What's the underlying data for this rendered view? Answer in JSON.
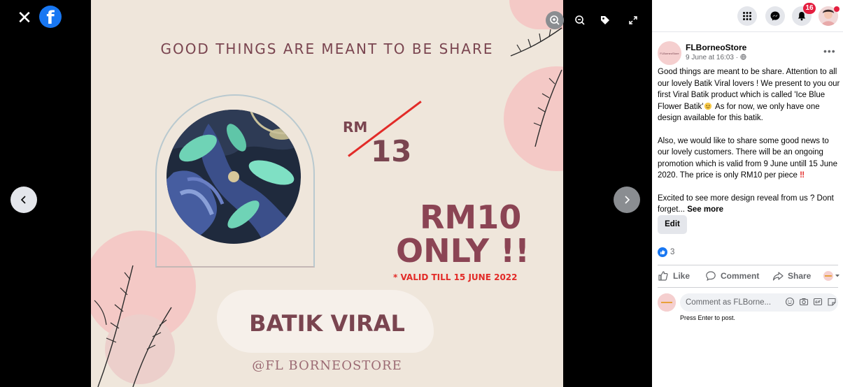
{
  "viewer": {
    "close_glyph": "✕",
    "fb_letter": "f",
    "poster": {
      "heading": "GOOD THINGS ARE MEANT TO BE SHARE",
      "old_currency": "RM",
      "old_value": "13",
      "new_price": "RM10",
      "only_text": "ONLY !!",
      "valid_text": "* VALID TILL 15 JUNE 2022",
      "brand": "BATIK VIRAL",
      "handle": "@FL BORNEOSTORE"
    },
    "colors": {
      "poster_bg": "#efe6db",
      "pink": "#f4c9c6",
      "maroon": "#7a4550",
      "red": "#e22b28"
    }
  },
  "topbar": {
    "notification_count": "16"
  },
  "post": {
    "page_name": "FLBorneoStore",
    "page_avatar_text": "FLBorneoStore",
    "timestamp": "9 June at 16:03",
    "meta_sep": " · ",
    "more": "•••",
    "para1_a": "Good things are meant to be share. Attention to all our lovely Batik Viral lovers ! We present to you our first Viral Batik product which is called 'Ice Blue Flower Batik'",
    "para1_b": " As for now, we only have one design available for this batik.",
    "para2_a": "Also, we would like to share some good news to our lovely customers. There will be an ongoing promotion which is valid from 9 June untill 15 June 2020. The price is only RM10 per piece ",
    "para2_b": "‼",
    "para3": "Excited to see more design reveal from us ? Dont forget... ",
    "see_more": "See more",
    "edit_label": "Edit",
    "reaction_count": "3",
    "like_label": "Like",
    "comment_label": "Comment",
    "share_label": "Share",
    "comment_placeholder": "Comment as FLBorne...",
    "press_enter": "Press Enter to post."
  }
}
